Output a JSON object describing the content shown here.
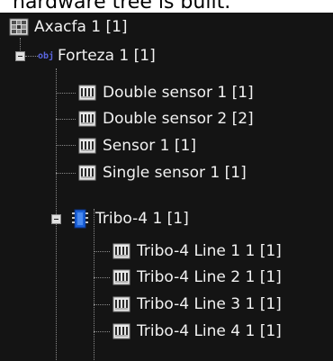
{
  "caption_text": "hardware tree is built.",
  "tree": {
    "root": {
      "label": "Axacfa 1 [1]",
      "icon": "hardware-grid-icon"
    },
    "forteza": {
      "label": "Forteza 1 [1]",
      "icon": "obj-icon",
      "icon_text": "obj",
      "expanded": true
    },
    "sensors": [
      {
        "label": "Double sensor 1 [1]",
        "icon": "sensor-module-icon"
      },
      {
        "label": "Double sensor 2 [2]",
        "icon": "sensor-module-icon"
      },
      {
        "label": "Sensor 1 [1]",
        "icon": "sensor-module-icon"
      },
      {
        "label": "Single sensor 1 [1]",
        "icon": "sensor-module-icon"
      }
    ],
    "tribo": {
      "label": "Tribo-4 1 [1]",
      "icon": "chip-icon",
      "expanded": true
    },
    "tribo_lines": [
      {
        "label": "Tribo-4 Line 1 1 [1]",
        "icon": "sensor-module-icon"
      },
      {
        "label": "Tribo-4 Line 2 1 [1]",
        "icon": "sensor-module-icon"
      },
      {
        "label": "Tribo-4 Line 3 1 [1]",
        "icon": "sensor-module-icon"
      },
      {
        "label": "Tribo-4 Line 4 1 [1]",
        "icon": "sensor-module-icon"
      }
    ]
  },
  "colors": {
    "background": "#141414",
    "text": "#f2f2f2",
    "tree_lines": "#8a8a8a",
    "chip_blue": "#1a5fd6",
    "obj_text": "#5a66e0"
  }
}
